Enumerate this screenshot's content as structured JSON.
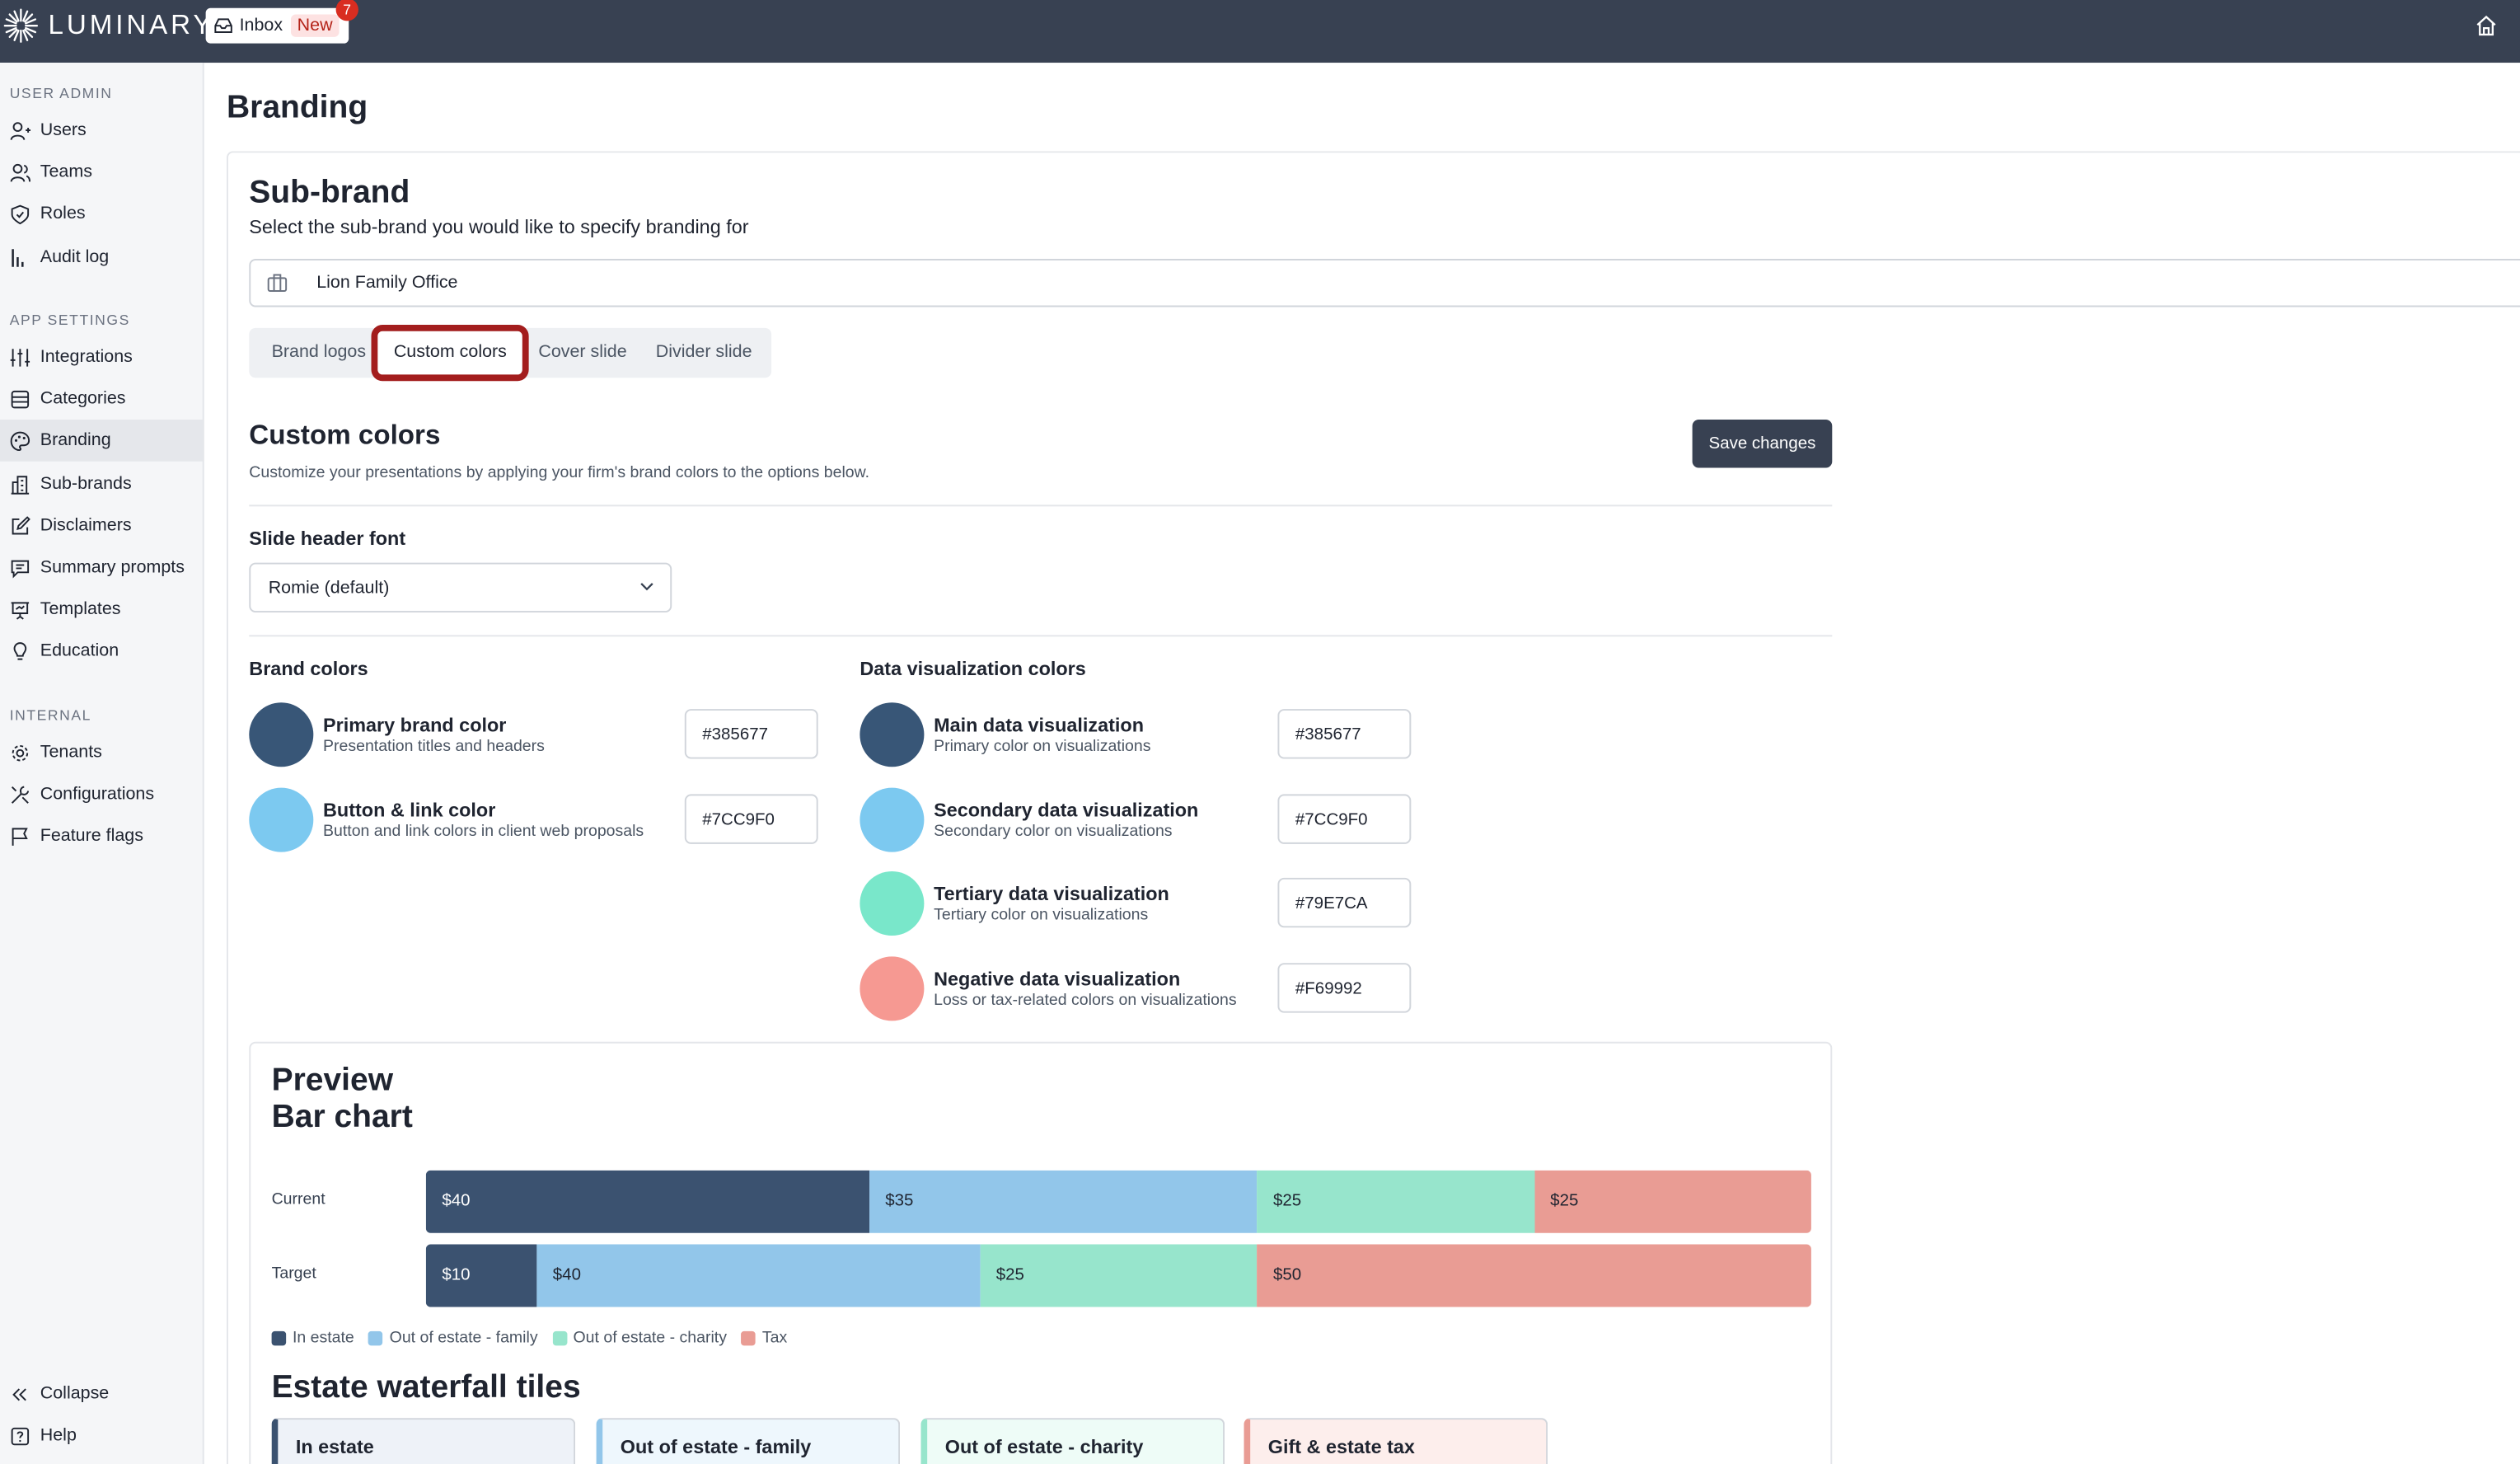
{
  "header": {
    "brand": "LUMINARY",
    "inbox_label": "Inbox",
    "inbox_tag": "New",
    "inbox_count": "7"
  },
  "sidebar": {
    "sections": [
      "USER ADMIN",
      "APP SETTINGS",
      "INTERNAL"
    ],
    "items": [
      {
        "label": "Users",
        "icon": "users-icon"
      },
      {
        "label": "Teams",
        "icon": "team-icon"
      },
      {
        "label": "Roles",
        "icon": "shield-icon"
      },
      {
        "label": "Audit log",
        "icon": "chart-icon"
      },
      {
        "label": "Integrations",
        "icon": "sliders-icon"
      },
      {
        "label": "Categories",
        "icon": "list-icon"
      },
      {
        "label": "Branding",
        "icon": "palette-icon"
      },
      {
        "label": "Sub-brands",
        "icon": "building-icon"
      },
      {
        "label": "Disclaimers",
        "icon": "edit-icon"
      },
      {
        "label": "Summary prompts",
        "icon": "chat-icon"
      },
      {
        "label": "Templates",
        "icon": "presentation-icon"
      },
      {
        "label": "Education",
        "icon": "bulb-icon"
      },
      {
        "label": "Tenants",
        "icon": "gear-icon"
      },
      {
        "label": "Configurations",
        "icon": "tools-icon"
      },
      {
        "label": "Feature flags",
        "icon": "flag-icon"
      }
    ],
    "collapse": "Collapse",
    "help": "Help"
  },
  "page": {
    "title": "Branding"
  },
  "subbrand": {
    "title": "Sub-brand",
    "subtitle": "Select the sub-brand you would like to specify branding for",
    "selected": "Lion Family Office"
  },
  "tabs": [
    "Brand logos",
    "Custom colors",
    "Cover slide",
    "Divider slide"
  ],
  "custom": {
    "title": "Custom colors",
    "subtitle": "Customize your presentations by applying your firm's brand colors to the options below.",
    "save": "Save changes",
    "font_label": "Slide header font",
    "font_value": "Romie (default)"
  },
  "brand_colors": {
    "title": "Brand colors",
    "items": [
      {
        "name": "Primary brand color",
        "desc": "Presentation titles and headers",
        "hex": "#385677",
        "color": "#385677"
      },
      {
        "name": "Button & link color",
        "desc": "Button and link colors in client web proposals",
        "hex": "#7CC9F0",
        "color": "#7CC9F0"
      }
    ]
  },
  "data_colors": {
    "title": "Data visualization colors",
    "items": [
      {
        "name": "Main data visualization",
        "desc": "Primary color on visualizations",
        "hex": "#385677",
        "color": "#385677"
      },
      {
        "name": "Secondary data visualization",
        "desc": "Secondary color on visualizations",
        "hex": "#7CC9F0",
        "color": "#7CC9F0"
      },
      {
        "name": "Tertiary data visualization",
        "desc": "Tertiary color on visualizations",
        "hex": "#79E7CA",
        "color": "#79E7CA"
      },
      {
        "name": "Negative data visualization",
        "desc": "Loss or tax-related colors on visualizations",
        "hex": "#F69992",
        "color": "#F69992"
      }
    ]
  },
  "preview": {
    "title": "Preview",
    "subtitle": "Bar chart",
    "waterfall_title": "Estate waterfall tiles",
    "tiles": [
      "In estate",
      "Out of estate - family",
      "Out of estate - charity",
      "Gift & estate tax"
    ]
  },
  "chart_data": {
    "type": "bar",
    "stacked": true,
    "orientation": "horizontal",
    "categories": [
      "Current",
      "Target"
    ],
    "series": [
      {
        "name": "In estate",
        "values": [
          40,
          10
        ],
        "labels": [
          "$40",
          "$10"
        ],
        "color": "#3b5270"
      },
      {
        "name": "Out of estate - family",
        "values": [
          35,
          40
        ],
        "labels": [
          "$35",
          "$40"
        ],
        "color": "#92c6ea"
      },
      {
        "name": "Out of estate - charity",
        "values": [
          25,
          25
        ],
        "labels": [
          "$25",
          "$25"
        ],
        "color": "#97e5cc"
      },
      {
        "name": "Tax",
        "values": [
          25,
          50
        ],
        "labels": [
          "$25",
          "$50"
        ],
        "color": "#e99c94"
      }
    ],
    "legend": "bottom-left"
  }
}
